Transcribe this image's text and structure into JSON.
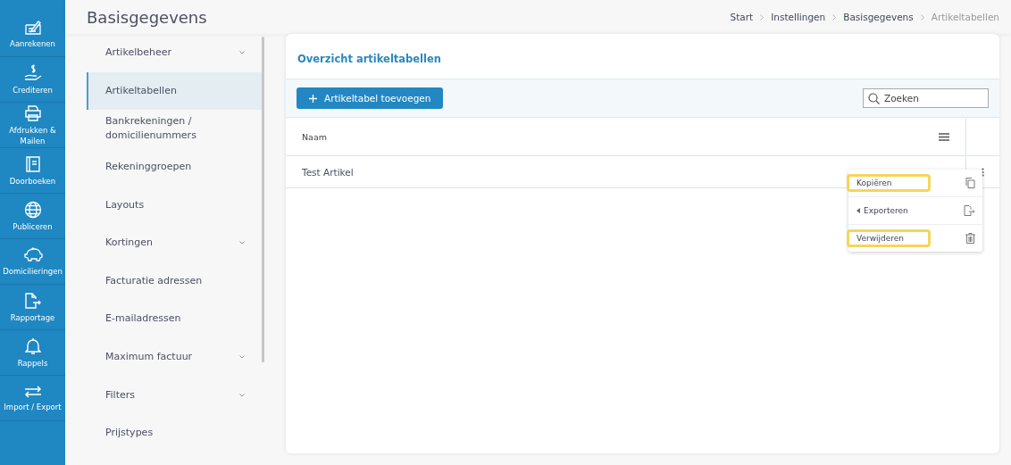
{
  "nav": [
    {
      "label": "Aanrekenen",
      "kind": "invoice"
    },
    {
      "label": "Crediteren",
      "kind": "credit"
    },
    {
      "label": "Afdrukken & Mailen",
      "kind": "print"
    },
    {
      "label": "Doorboeken",
      "kind": "book"
    },
    {
      "label": "Publiceren",
      "kind": "publish"
    },
    {
      "label": "Domicilieringen",
      "kind": "savings"
    },
    {
      "label": "Rapportage",
      "kind": "report"
    },
    {
      "label": "Rappels",
      "kind": "reminder"
    },
    {
      "label": "Import / Export",
      "kind": "transfer"
    }
  ],
  "page_title": "Basisgegevens",
  "breadcrumb": [
    {
      "label": "Start",
      "current": false
    },
    {
      "label": "Instellingen",
      "current": false
    },
    {
      "label": "Basisgegevens",
      "current": false
    },
    {
      "label": "Artikeltabellen",
      "current": true
    }
  ],
  "submenu": [
    {
      "label": "Artikelbeheer",
      "selected": false,
      "expandable": true
    },
    {
      "label": "Artikeltabellen",
      "selected": true,
      "expandable": false
    },
    {
      "label": "Bankrekeningen / domicilienummers",
      "selected": false,
      "expandable": false
    },
    {
      "label": "Rekeninggroepen",
      "selected": false,
      "expandable": false
    },
    {
      "label": "Layouts",
      "selected": false,
      "expandable": false
    },
    {
      "label": "Kortingen",
      "selected": false,
      "expandable": true
    },
    {
      "label": "Facturatie adressen",
      "selected": false,
      "expandable": false
    },
    {
      "label": "E-mailadressen",
      "selected": false,
      "expandable": false
    },
    {
      "label": "Maximum factuur",
      "selected": false,
      "expandable": true
    },
    {
      "label": "Filters",
      "selected": false,
      "expandable": true
    },
    {
      "label": "Prijstypes",
      "selected": false,
      "expandable": false
    }
  ],
  "card": {
    "title": "Overzicht artikeltabellen",
    "add_button": "Artikeltabel toevoegen",
    "search": {
      "placeholder": "Zoeken"
    },
    "table": {
      "columns": [
        "Naam"
      ],
      "rows": [
        [
          "Test Artikel"
        ]
      ]
    }
  },
  "context_menu": [
    {
      "label": "Kopiëren",
      "kind": "copy",
      "submenu": false,
      "highlighted": true
    },
    {
      "label": "Exporteren",
      "kind": "export",
      "submenu": true,
      "highlighted": false
    },
    {
      "label": "Verwijderen",
      "kind": "delete",
      "submenu": false,
      "highlighted": true
    }
  ]
}
